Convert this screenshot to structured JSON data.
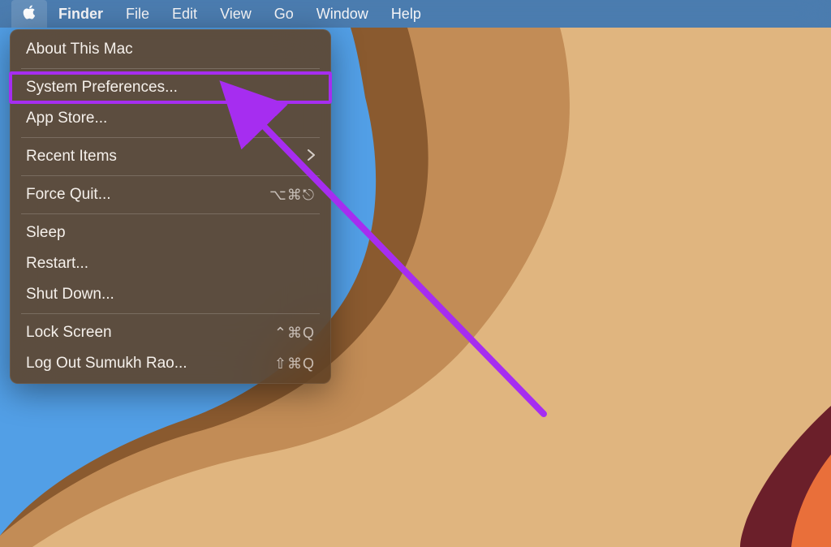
{
  "menubar": {
    "app_name": "Finder",
    "items": [
      "File",
      "Edit",
      "View",
      "Go",
      "Window",
      "Help"
    ]
  },
  "apple_menu": {
    "about": "About This Mac",
    "system_preferences": "System Preferences...",
    "app_store": "App Store...",
    "recent_items": "Recent Items",
    "force_quit": "Force Quit...",
    "force_quit_shortcut": "⌥⌘⎋",
    "sleep": "Sleep",
    "restart": "Restart...",
    "shutdown": "Shut Down...",
    "lock_screen": "Lock Screen",
    "lock_screen_shortcut": "⌃⌘Q",
    "log_out": "Log Out Sumukh Rao...",
    "log_out_shortcut": "⇧⌘Q"
  },
  "colors": {
    "annotation": "#a62df0"
  }
}
